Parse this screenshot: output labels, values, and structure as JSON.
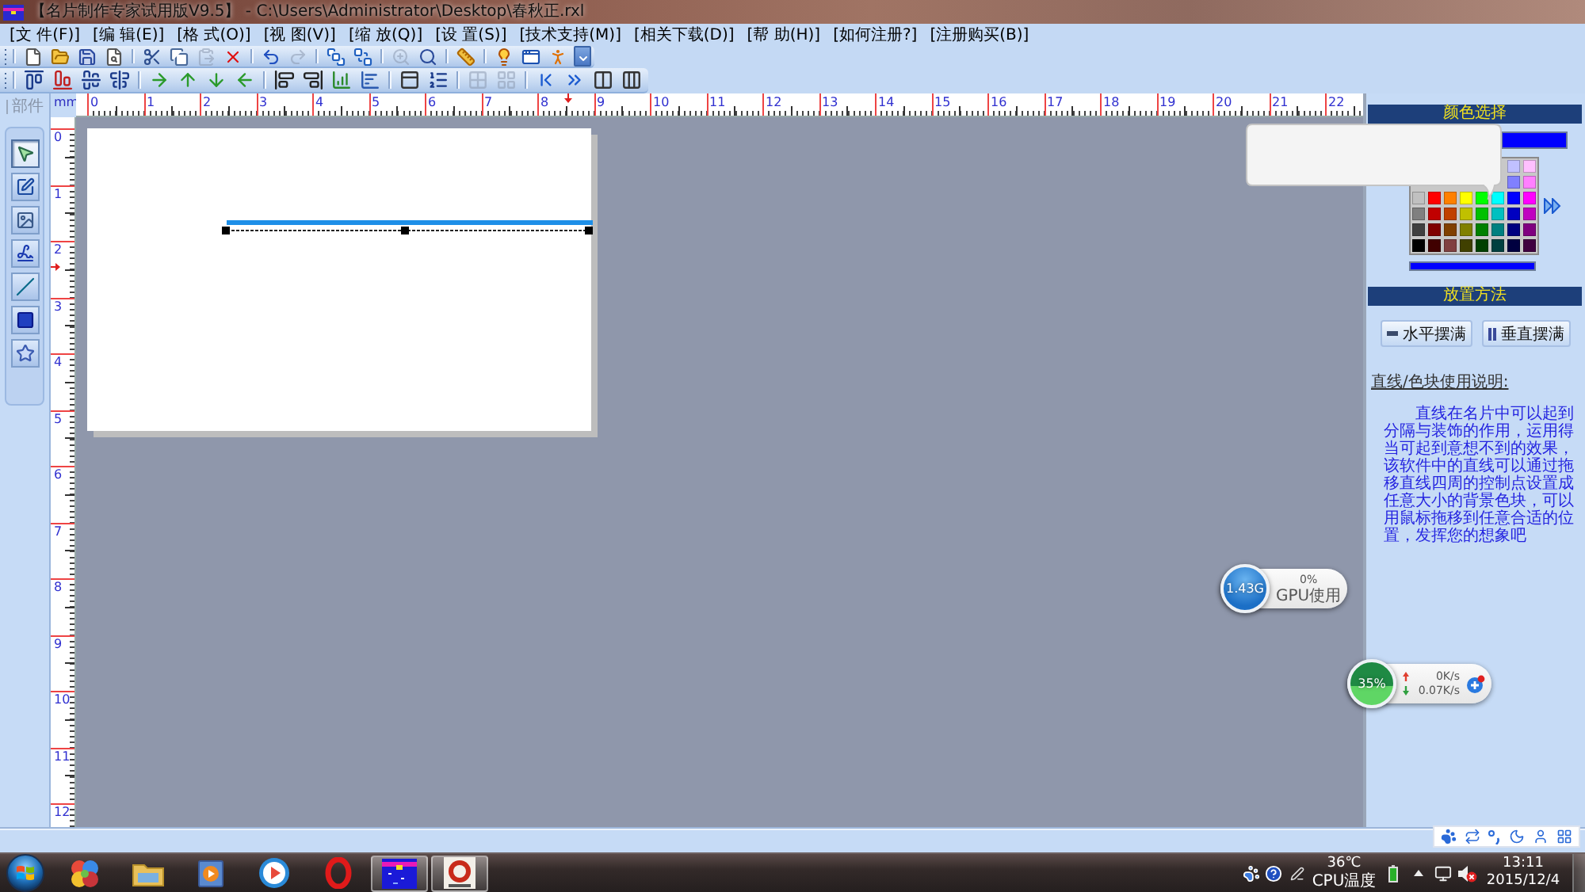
{
  "window": {
    "title": "【名片制作专家试用版V9.5】 - C:\\Users\\Administrator\\Desktop\\春秋正.rxl"
  },
  "menu": [
    {
      "label": "[文 件(F)]"
    },
    {
      "label": "[编 辑(E)]"
    },
    {
      "label": "[格 式(O)]"
    },
    {
      "label": "[视 图(V)]"
    },
    {
      "label": "[缩 放(Q)]"
    },
    {
      "label": "[设 置(S)]"
    },
    {
      "label": "[技术支持(M)]"
    },
    {
      "label": "[相关下载(D)]"
    },
    {
      "label": "[帮 助(H)]"
    },
    {
      "label": "[如何注册?]"
    },
    {
      "label": "[注册购买(B)]"
    }
  ],
  "toolbars": [
    {
      "groups": [
        [
          {
            "disabled": false
          },
          {
            "disabled": false
          },
          {
            "disabled": false
          },
          {
            "disabled": false
          }
        ],
        [
          {
            "disabled": false
          },
          {
            "disabled": false
          },
          {
            "disabled": true
          },
          {
            "disabled": false
          }
        ],
        [
          {
            "disabled": false
          },
          {
            "disabled": true
          }
        ],
        [
          {
            "disabled": false
          },
          {
            "disabled": false
          }
        ],
        [
          {
            "disabled": true
          },
          {
            "disabled": false
          }
        ],
        [
          {
            "disabled": false
          }
        ],
        [
          {
            "disabled": false
          },
          {
            "disabled": false
          },
          {
            "disabled": false
          }
        ]
      ]
    },
    {
      "groups": [
        [
          {
            "disabled": false
          },
          {
            "disabled": false
          },
          {
            "disabled": false
          },
          {
            "disabled": false
          }
        ],
        [
          {
            "disabled": false
          },
          {
            "disabled": false
          },
          {
            "disabled": false
          },
          {
            "disabled": false
          }
        ],
        [
          {
            "disabled": false
          },
          {
            "disabled": false
          },
          {
            "disabled": false
          },
          {
            "disabled": false
          }
        ],
        [
          {
            "disabled": false
          },
          {
            "disabled": false
          }
        ],
        [
          {
            "disabled": true
          },
          {
            "disabled": true
          }
        ],
        [
          {
            "disabled": false
          },
          {
            "disabled": false
          },
          {
            "disabled": false
          },
          {
            "disabled": false
          }
        ]
      ]
    }
  ],
  "parts_panel": {
    "title": "部件",
    "tools": [
      {
        "selected": true
      },
      {
        "selected": false
      },
      {
        "selected": false
      },
      {
        "selected": false
      },
      {
        "selected": false
      },
      {
        "selected": false
      },
      {
        "selected": false
      }
    ]
  },
  "rulers": {
    "unit": "mm",
    "horizontal": [
      "0",
      "1",
      "2",
      "3",
      "4",
      "5",
      "6",
      "7",
      "8",
      "9",
      "10",
      "11",
      "12",
      "13",
      "14",
      "15",
      "16",
      "17",
      "18",
      "19",
      "20",
      "21",
      "22"
    ],
    "vertical": [
      "0",
      "1",
      "2",
      "3",
      "4",
      "5",
      "6",
      "7",
      "8",
      "9",
      "10",
      "11",
      "12"
    ]
  },
  "color_panel": {
    "title": "颜色选择",
    "color_bars": [
      {
        "color": "#0000ff"
      },
      {
        "color": "#0000ff"
      }
    ],
    "swatch_rows": [
      {
        "swatches": [
          {
            "color": "#c0c0ff"
          },
          {
            "color": "#ffc0ff"
          }
        ]
      },
      {
        "swatches": [
          {
            "color": "#8080ff"
          },
          {
            "color": "#ff80ff"
          }
        ]
      },
      {
        "swatches": [
          {
            "color": "#c0c0c0"
          },
          {
            "color": "#ff0000"
          },
          {
            "color": "#ff8000"
          },
          {
            "color": "#ffff00"
          },
          {
            "color": "#00ff00"
          },
          {
            "color": "#00ffff"
          },
          {
            "color": "#0000ff"
          },
          {
            "color": "#ff00ff"
          }
        ]
      },
      {
        "swatches": [
          {
            "color": "#808080"
          },
          {
            "color": "#c00000"
          },
          {
            "color": "#c04000"
          },
          {
            "color": "#c0c000"
          },
          {
            "color": "#00c000"
          },
          {
            "color": "#00c0c0"
          },
          {
            "color": "#0000c0"
          },
          {
            "color": "#c000c0"
          }
        ]
      },
      {
        "swatches": [
          {
            "color": "#404040"
          },
          {
            "color": "#800000"
          },
          {
            "color": "#804000"
          },
          {
            "color": "#808000"
          },
          {
            "color": "#008000"
          },
          {
            "color": "#008080"
          },
          {
            "color": "#000080"
          },
          {
            "color": "#800080"
          }
        ]
      },
      {
        "swatches": [
          {
            "color": "#000000"
          },
          {
            "color": "#400000"
          },
          {
            "color": "#804040"
          },
          {
            "color": "#404000"
          },
          {
            "color": "#004000"
          },
          {
            "color": "#004040"
          },
          {
            "color": "#000040"
          },
          {
            "color": "#400040"
          }
        ]
      }
    ]
  },
  "placement_panel": {
    "title": "放置方法",
    "buttons": [
      {
        "kind": "horizontal",
        "label": "水平摆满"
      },
      {
        "kind": "vertical",
        "label": "垂直摆满"
      }
    ]
  },
  "help": {
    "heading": "直线/色块使用说明:",
    "text": "直线在名片中可以起到分隔与装饰的作用，运用得当可起到意想不到的效果，该软件中的直线可以通过拖移直线四周的控制点设置成任意大小的背景色块，可以用鼠标拖移到任意合适的位置，发挥您的想象吧"
  },
  "desktop_widgets": {
    "gpu": {
      "memory": "1.43G",
      "usage": "0%",
      "label": "GPU使用"
    },
    "network": {
      "load": "35%",
      "upload": "0K/s",
      "download": "0.07K/s"
    }
  },
  "taskbar": {
    "apps": [
      {
        "active": false
      },
      {
        "active": false
      },
      {
        "active": false
      },
      {
        "active": false
      },
      {
        "active": false
      },
      {
        "active": true
      },
      {
        "active": true
      }
    ],
    "temperature": "36℃",
    "temperature_label": "CPU温度",
    "time": "13:11",
    "date": "2015/12/4"
  }
}
